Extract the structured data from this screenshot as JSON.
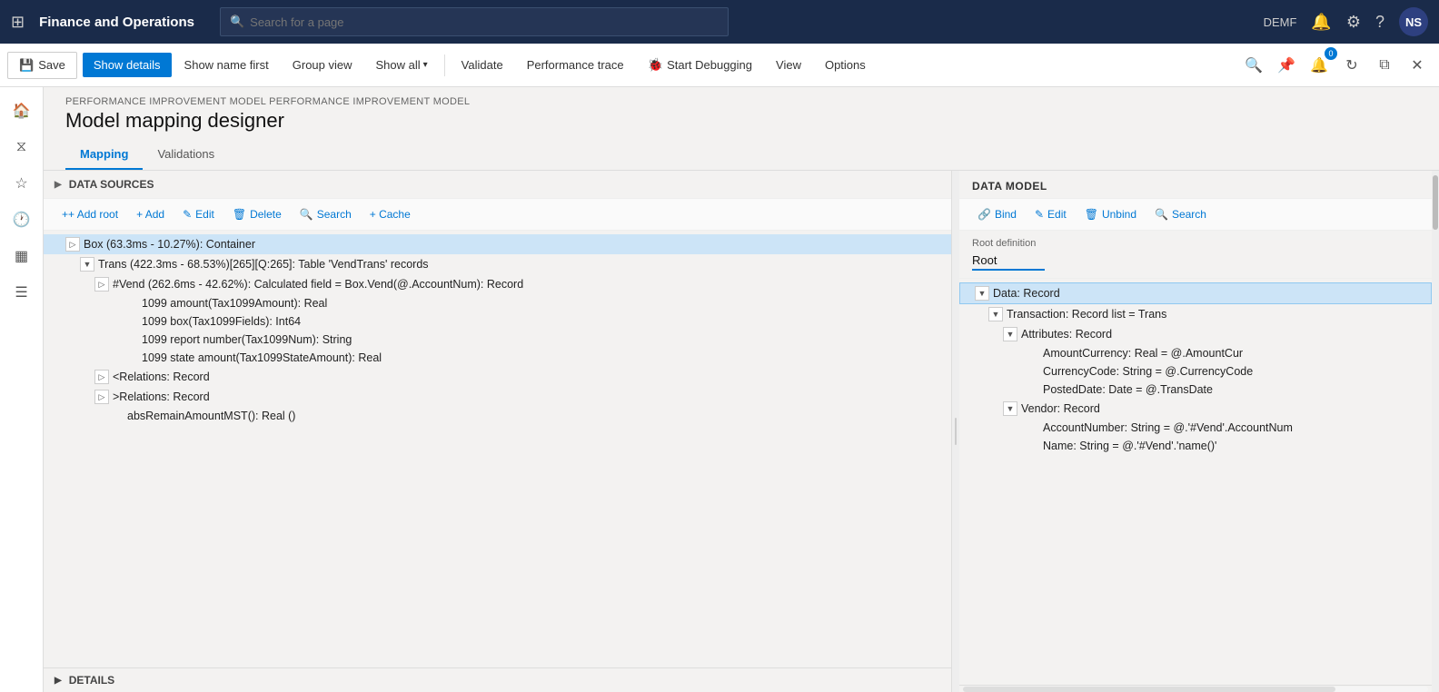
{
  "topnav": {
    "app_title": "Finance and Operations",
    "search_placeholder": "Search for a page",
    "user": "DEMF",
    "avatar_initials": "NS"
  },
  "toolbar": {
    "save_label": "Save",
    "show_details_label": "Show details",
    "show_name_first_label": "Show name first",
    "group_view_label": "Group view",
    "show_all_label": "Show all",
    "validate_label": "Validate",
    "performance_trace_label": "Performance trace",
    "start_debugging_label": "Start Debugging",
    "view_label": "View",
    "options_label": "Options",
    "notification_count": "0"
  },
  "page": {
    "breadcrumb": "PERFORMANCE IMPROVEMENT MODEL PERFORMANCE IMPROVEMENT MODEL",
    "title": "Model mapping designer",
    "tabs": [
      {
        "id": "mapping",
        "label": "Mapping",
        "active": true
      },
      {
        "id": "validations",
        "label": "Validations",
        "active": false
      }
    ]
  },
  "data_sources": {
    "header": "DATA SOURCES",
    "toolbar": {
      "add_root": "+ Add root",
      "add": "+ Add",
      "edit": "Edit",
      "delete": "Delete",
      "search": "Search",
      "cache": "+ Cache"
    },
    "tree": [
      {
        "id": "box",
        "label": "Box (63.3ms - 10.27%): Container",
        "level": 0,
        "expanded": true,
        "selected": true,
        "has_children": true
      },
      {
        "id": "trans",
        "label": "Trans (422.3ms - 68.53%)[265][Q:265]: Table 'VendTrans' records",
        "level": 1,
        "expanded": true,
        "selected": false,
        "has_children": true
      },
      {
        "id": "vend",
        "label": "#Vend (262.6ms - 42.62%): Calculated field = Box.Vend(@.AccountNum): Record",
        "level": 2,
        "expanded": false,
        "selected": false,
        "has_children": true
      },
      {
        "id": "1099amount",
        "label": "1099 amount(Tax1099Amount): Real",
        "level": 3,
        "expanded": false,
        "selected": false,
        "has_children": false
      },
      {
        "id": "1099box",
        "label": "1099 box(Tax1099Fields): Int64",
        "level": 3,
        "expanded": false,
        "selected": false,
        "has_children": false
      },
      {
        "id": "1099report",
        "label": "1099 report number(Tax1099Num): String",
        "level": 3,
        "expanded": false,
        "selected": false,
        "has_children": false
      },
      {
        "id": "1099state",
        "label": "1099 state amount(Tax1099StateAmount): Real",
        "level": 3,
        "expanded": false,
        "selected": false,
        "has_children": false
      },
      {
        "id": "relationslt",
        "label": "<Relations: Record",
        "level": 2,
        "expanded": false,
        "selected": false,
        "has_children": true
      },
      {
        "id": "relationsgt",
        "label": ">Relations: Record",
        "level": 2,
        "expanded": false,
        "selected": false,
        "has_children": true
      },
      {
        "id": "absremain",
        "label": "absRemainAmountMST(): Real ()",
        "level": 2,
        "expanded": false,
        "selected": false,
        "has_children": false
      }
    ]
  },
  "data_model": {
    "header": "DATA MODEL",
    "toolbar": {
      "bind": "Bind",
      "edit": "Edit",
      "unbind": "Unbind",
      "search": "Search"
    },
    "root_definition_label": "Root definition",
    "root_value": "Root",
    "tree": [
      {
        "id": "data",
        "label": "Data: Record",
        "level": 0,
        "expanded": true,
        "selected": true,
        "has_children": true
      },
      {
        "id": "transaction",
        "label": "Transaction: Record list = Trans",
        "level": 1,
        "expanded": true,
        "selected": false,
        "has_children": true
      },
      {
        "id": "attributes",
        "label": "Attributes: Record",
        "level": 2,
        "expanded": true,
        "selected": false,
        "has_children": true
      },
      {
        "id": "amountcurrency",
        "label": "AmountCurrency: Real = @.AmountCur",
        "level": 3,
        "expanded": false,
        "selected": false,
        "has_children": false
      },
      {
        "id": "currencycode",
        "label": "CurrencyCode: String = @.CurrencyCode",
        "level": 3,
        "expanded": false,
        "selected": false,
        "has_children": false
      },
      {
        "id": "posteddate",
        "label": "PostedDate: Date = @.TransDate",
        "level": 3,
        "expanded": false,
        "selected": false,
        "has_children": false
      },
      {
        "id": "vendor",
        "label": "Vendor: Record",
        "level": 2,
        "expanded": true,
        "selected": false,
        "has_children": true
      },
      {
        "id": "accountnumber",
        "label": "AccountNumber: String = @.'#Vend'.AccountNum",
        "level": 3,
        "expanded": false,
        "selected": false,
        "has_children": false
      },
      {
        "id": "name",
        "label": "Name: String = @.'#Vend'.'name()'",
        "level": 3,
        "expanded": false,
        "selected": false,
        "has_children": false
      }
    ]
  },
  "details": {
    "header": "DETAILS"
  }
}
